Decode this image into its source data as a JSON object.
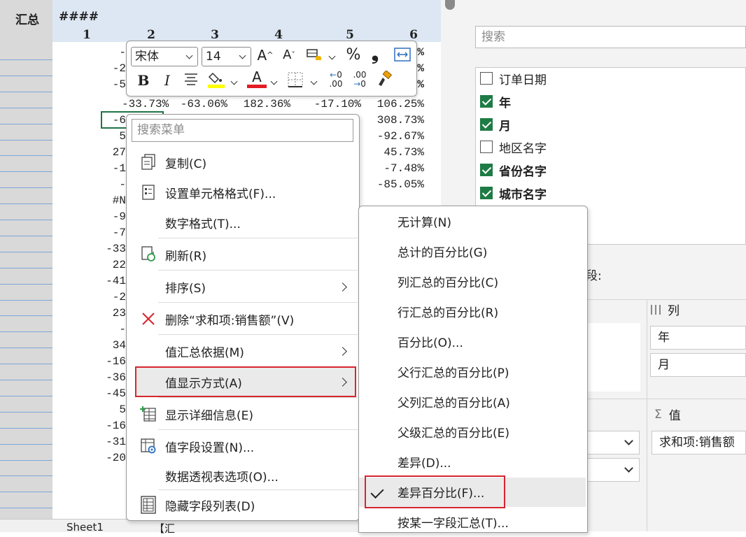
{
  "sheet": {
    "row_header_label": "汇总",
    "col_header_label": "####",
    "column_numbers": [
      "1",
      "2",
      "3",
      "4",
      "5",
      "6"
    ],
    "visible_cells": [
      {
        "col": 2,
        "text": "-"
      },
      {
        "col": 2,
        "text": "-2"
      },
      {
        "col": 2,
        "text": "-5"
      },
      {
        "col": 2,
        "text": "-33.73%"
      },
      {
        "col": 3,
        "text": "-63.06%"
      },
      {
        "col": 4,
        "text": "182.36%"
      },
      {
        "col": 5,
        "text": "-17.10%"
      },
      {
        "col": 6,
        "text": "106.25%"
      },
      {
        "col": 2,
        "text": "-6"
      },
      {
        "col": 6,
        "text": "308.73%"
      },
      {
        "col": 2,
        "text": "5"
      },
      {
        "col": 6,
        "text": "-92.67%"
      },
      {
        "col": 2,
        "text": "27"
      },
      {
        "col": 6,
        "text": "45.73%"
      },
      {
        "col": 2,
        "text": "-1"
      },
      {
        "col": 6,
        "text": "-7.48%"
      },
      {
        "col": 2,
        "text": "-"
      },
      {
        "col": 6,
        "text": "-85.05%"
      },
      {
        "col": 2,
        "text": "#N"
      },
      {
        "col": 2,
        "text": "-9"
      },
      {
        "col": 2,
        "text": "-7"
      },
      {
        "col": 2,
        "text": "-33"
      },
      {
        "col": 2,
        "text": "22"
      },
      {
        "col": 2,
        "text": "-41"
      },
      {
        "col": 2,
        "text": "-2"
      },
      {
        "col": 2,
        "text": "23"
      },
      {
        "col": 2,
        "text": "-"
      },
      {
        "col": 2,
        "text": "34"
      },
      {
        "col": 2,
        "text": "-16"
      },
      {
        "col": 2,
        "text": "-36"
      },
      {
        "col": 2,
        "text": "-45"
      },
      {
        "col": 2,
        "text": "5"
      },
      {
        "col": 2,
        "text": "-16"
      },
      {
        "col": 2,
        "text": "-31"
      },
      {
        "col": 2,
        "text": "-20"
      },
      {
        "col": 6,
        "text": "%"
      },
      {
        "col": 6,
        "text": "%"
      },
      {
        "col": 6,
        "text": "%"
      }
    ],
    "tabs": [
      "Sheet1",
      "【汇"
    ]
  },
  "mini_toolbar": {
    "font_name": "宋体",
    "font_size": "14",
    "increase_font_icon": "A^",
    "decrease_font_icon": "Aˇ",
    "percent_symbol": "%",
    "comma_symbol": "❟",
    "bold_label": "B",
    "italic_label": "I",
    "font_color_label": "A",
    "increase_decimal_label": ".00",
    "decrease_decimal_label": ".00",
    "fill_color": "#ffff00",
    "font_color": "#e31b23"
  },
  "context_menu": {
    "search_placeholder": "搜索菜单",
    "items": [
      {
        "label": "复制(C)",
        "icon": "copy-icon"
      },
      {
        "label": "设置单元格格式(F)...",
        "icon": "format-cells-icon"
      },
      {
        "label": "数字格式(T)...",
        "icon": ""
      },
      {
        "label": "刷新(R)",
        "icon": "refresh-icon"
      },
      {
        "label": "排序(S)",
        "icon": "",
        "submenu": true
      },
      {
        "label": "删除“求和项:销售额”(V)",
        "icon": "delete-icon"
      },
      {
        "label": "值汇总依据(M)",
        "icon": "",
        "submenu": true
      },
      {
        "label": "值显示方式(A)",
        "icon": "",
        "submenu": true,
        "active": true
      },
      {
        "label": "显示详细信息(E)",
        "icon": "show-details-icon"
      },
      {
        "label": "值字段设置(N)...",
        "icon": "field-settings-icon"
      },
      {
        "label": "数据透视表选项(O)...",
        "icon": ""
      },
      {
        "label": "隐藏字段列表(D)",
        "icon": "field-list-icon"
      }
    ]
  },
  "submenu": {
    "items": [
      {
        "label": "无计算(N)"
      },
      {
        "label": "总计的百分比(G)"
      },
      {
        "label": "列汇总的百分比(C)"
      },
      {
        "label": "行汇总的百分比(R)"
      },
      {
        "label": "百分比(O)..."
      },
      {
        "label": "父行汇总的百分比(P)"
      },
      {
        "label": "父列汇总的百分比(A)"
      },
      {
        "label": "父级汇总的百分比(E)"
      },
      {
        "label": "差异(D)..."
      },
      {
        "label": "差异百分比(F)...",
        "checked": true
      },
      {
        "label": "按某一字段汇总(T)..."
      }
    ]
  },
  "field_panel": {
    "search_placeholder": "搜索",
    "fields": [
      {
        "label": "订单日期",
        "checked": false
      },
      {
        "label": "年",
        "checked": true
      },
      {
        "label": "月",
        "checked": true
      },
      {
        "label": "地区名字",
        "checked": false
      },
      {
        "label": "省份名字",
        "checked": true
      },
      {
        "label": "城市名字",
        "checked": true
      }
    ],
    "areas_label": "字段:",
    "columns_label": "列",
    "columns": [
      "年",
      "月"
    ],
    "values_label": "值",
    "values": [
      "求和项:销售额"
    ],
    "sigma_symbol": "Σ"
  },
  "colors": {
    "accent_green": "#1e7b45",
    "highlight_red": "#d7262e",
    "header_blue": "#dde7f3"
  }
}
